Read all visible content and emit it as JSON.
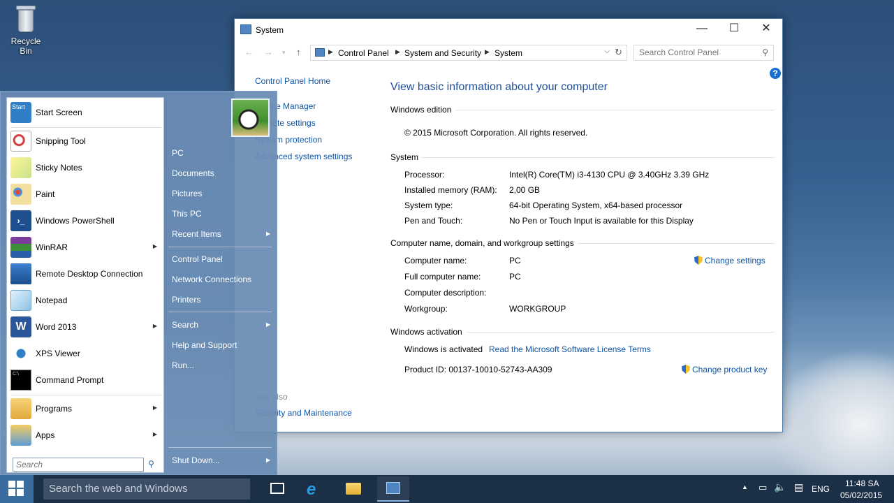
{
  "desktop": {
    "recycle_bin_label": "Recycle Bin"
  },
  "window": {
    "title": "System",
    "controls": {
      "minimize": "—",
      "maximize": "☐",
      "close": "✕"
    },
    "breadcrumb": [
      "Control Panel",
      "System and Security",
      "System"
    ],
    "search_placeholder": "Search Control Panel",
    "help": "?",
    "left_nav": {
      "home": "Control Panel Home",
      "device_manager": "Device Manager",
      "remote_settings": "Remote settings",
      "system_protection": "System protection",
      "advanced_settings": "Advanced system settings",
      "see_also": "See also",
      "security_maintenance": "Security and Maintenance"
    },
    "heading": "View basic information about your computer",
    "edition": {
      "title": "Windows edition",
      "copyright": "© 2015 Microsoft Corporation. All rights reserved."
    },
    "system": {
      "title": "System",
      "rows": [
        {
          "label": "Processor:",
          "value": "Intel(R) Core(TM) i3-4130 CPU @ 3.40GHz   3.39 GHz"
        },
        {
          "label": "Installed memory (RAM):",
          "value": "2,00 GB"
        },
        {
          "label": "System type:",
          "value": "64-bit Operating System, x64-based processor"
        },
        {
          "label": "Pen and Touch:",
          "value": "No Pen or Touch Input is available for this Display"
        }
      ]
    },
    "computer_name": {
      "title": "Computer name, domain, and workgroup settings",
      "change_settings": "Change settings",
      "rows": [
        {
          "label": "Computer name:",
          "value": "PC"
        },
        {
          "label": "Full computer name:",
          "value": "PC"
        },
        {
          "label": "Computer description:",
          "value": ""
        },
        {
          "label": "Workgroup:",
          "value": "WORKGROUP"
        }
      ]
    },
    "activation": {
      "title": "Windows activation",
      "status": "Windows is activated",
      "license_link": "Read the Microsoft Software License Terms",
      "product_id": "Product ID:  00137-10010-52743-AA309",
      "change_key": "Change product key"
    }
  },
  "start_menu": {
    "programs": [
      {
        "label": "Start Screen",
        "icon": "start-screen-icon",
        "arrow": false
      },
      {
        "label": "Snipping Tool",
        "icon": "snipping-tool-icon",
        "arrow": false
      },
      {
        "label": "Sticky Notes",
        "icon": "sticky-notes-icon",
        "arrow": false
      },
      {
        "label": "Paint",
        "icon": "paint-icon",
        "arrow": false
      },
      {
        "label": "Windows PowerShell",
        "icon": "powershell-icon",
        "arrow": false
      },
      {
        "label": "WinRAR",
        "icon": "winrar-icon",
        "arrow": true
      },
      {
        "label": "Remote Desktop Connection",
        "icon": "remote-desktop-icon",
        "arrow": false
      },
      {
        "label": "Notepad",
        "icon": "notepad-icon",
        "arrow": false
      },
      {
        "label": "Word 2013",
        "icon": "word-icon",
        "arrow": true
      },
      {
        "label": "XPS Viewer",
        "icon": "xps-viewer-icon",
        "arrow": false
      },
      {
        "label": "Command Prompt",
        "icon": "command-prompt-icon",
        "arrow": false
      }
    ],
    "bottom": [
      {
        "label": "Programs",
        "icon": "programs-icon"
      },
      {
        "label": "Apps",
        "icon": "apps-icon"
      }
    ],
    "start_screen_tile": "Start",
    "search_placeholder": "Search",
    "right": {
      "pc": "PC",
      "documents": "Documents",
      "pictures": "Pictures",
      "this_pc": "This PC",
      "recent_items": "Recent Items",
      "control_panel": "Control Panel",
      "network_connections": "Network Connections",
      "printers": "Printers",
      "search": "Search",
      "help_support": "Help and Support",
      "run": "Run...",
      "shut_down": "Shut Down..."
    }
  },
  "taskbar": {
    "search_placeholder": "Search the web and Windows",
    "language": "ENG",
    "time": "11:48 SA",
    "date": "05/02/2015"
  }
}
